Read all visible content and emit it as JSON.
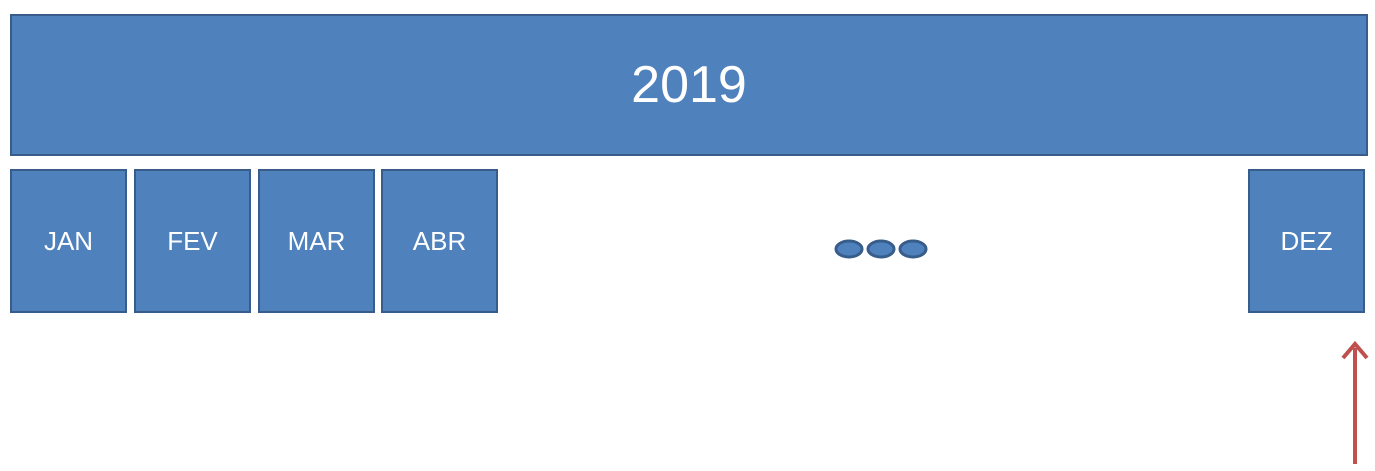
{
  "colors": {
    "box_fill": "#4f81bd",
    "box_border": "#385d8a",
    "box_text": "#ffffff",
    "arrow": "#c0504d"
  },
  "year": {
    "label": "2019"
  },
  "months": [
    {
      "label": "JAN"
    },
    {
      "label": "FEV"
    },
    {
      "label": "MAR"
    },
    {
      "label": "ABR"
    },
    {
      "label": "DEZ"
    }
  ],
  "ellipsis_icon": "ellipsis-dots-icon",
  "marker_icon": "up-arrow-icon"
}
